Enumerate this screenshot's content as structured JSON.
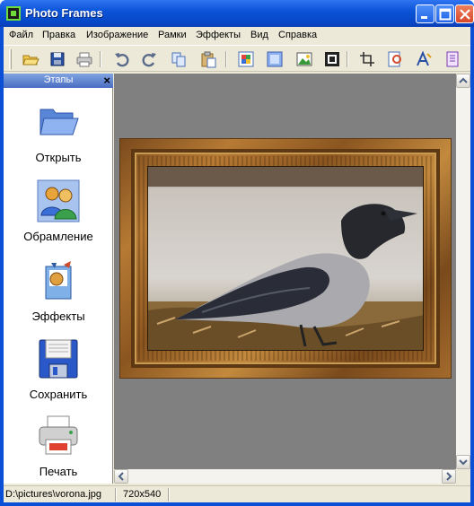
{
  "window": {
    "title": "Photo Frames",
    "accent": "#0a4fd6",
    "buttons": [
      {
        "name": "minimize",
        "icon": "minimize-icon"
      },
      {
        "name": "maximize",
        "icon": "maximize-icon"
      },
      {
        "name": "close",
        "icon": "close-icon"
      }
    ]
  },
  "menu": [
    "Файл",
    "Правка",
    "Изображение",
    "Рамки",
    "Эффекты",
    "Вид",
    "Справка"
  ],
  "toolbar": {
    "icons": [
      "open-folder-icon",
      "save-icon",
      "print-icon",
      "undo-icon",
      "redo-icon",
      "copy-icon",
      "paste-icon",
      "frame-color-icon",
      "mask-icon",
      "picture-icon",
      "frame-border-icon",
      "crop-icon",
      "adjust-icon",
      "text-icon",
      "document-icon"
    ]
  },
  "steps": {
    "title": "Этапы",
    "items": [
      {
        "label": "Открыть",
        "icon": "open-folder-icon"
      },
      {
        "label": "Обрамление",
        "icon": "framing-people-icon"
      },
      {
        "label": "Эффекты",
        "icon": "effects-icon"
      },
      {
        "label": "Сохранить",
        "icon": "floppy-disk-icon"
      },
      {
        "label": "Печать",
        "icon": "printer-icon"
      }
    ]
  },
  "canvas": {
    "background": "#808080",
    "image": "framed photo of a hooded crow on a sidewalk"
  },
  "status": {
    "path": "D:\\pictures\\vorona.jpg",
    "dimensions": "720x540"
  }
}
